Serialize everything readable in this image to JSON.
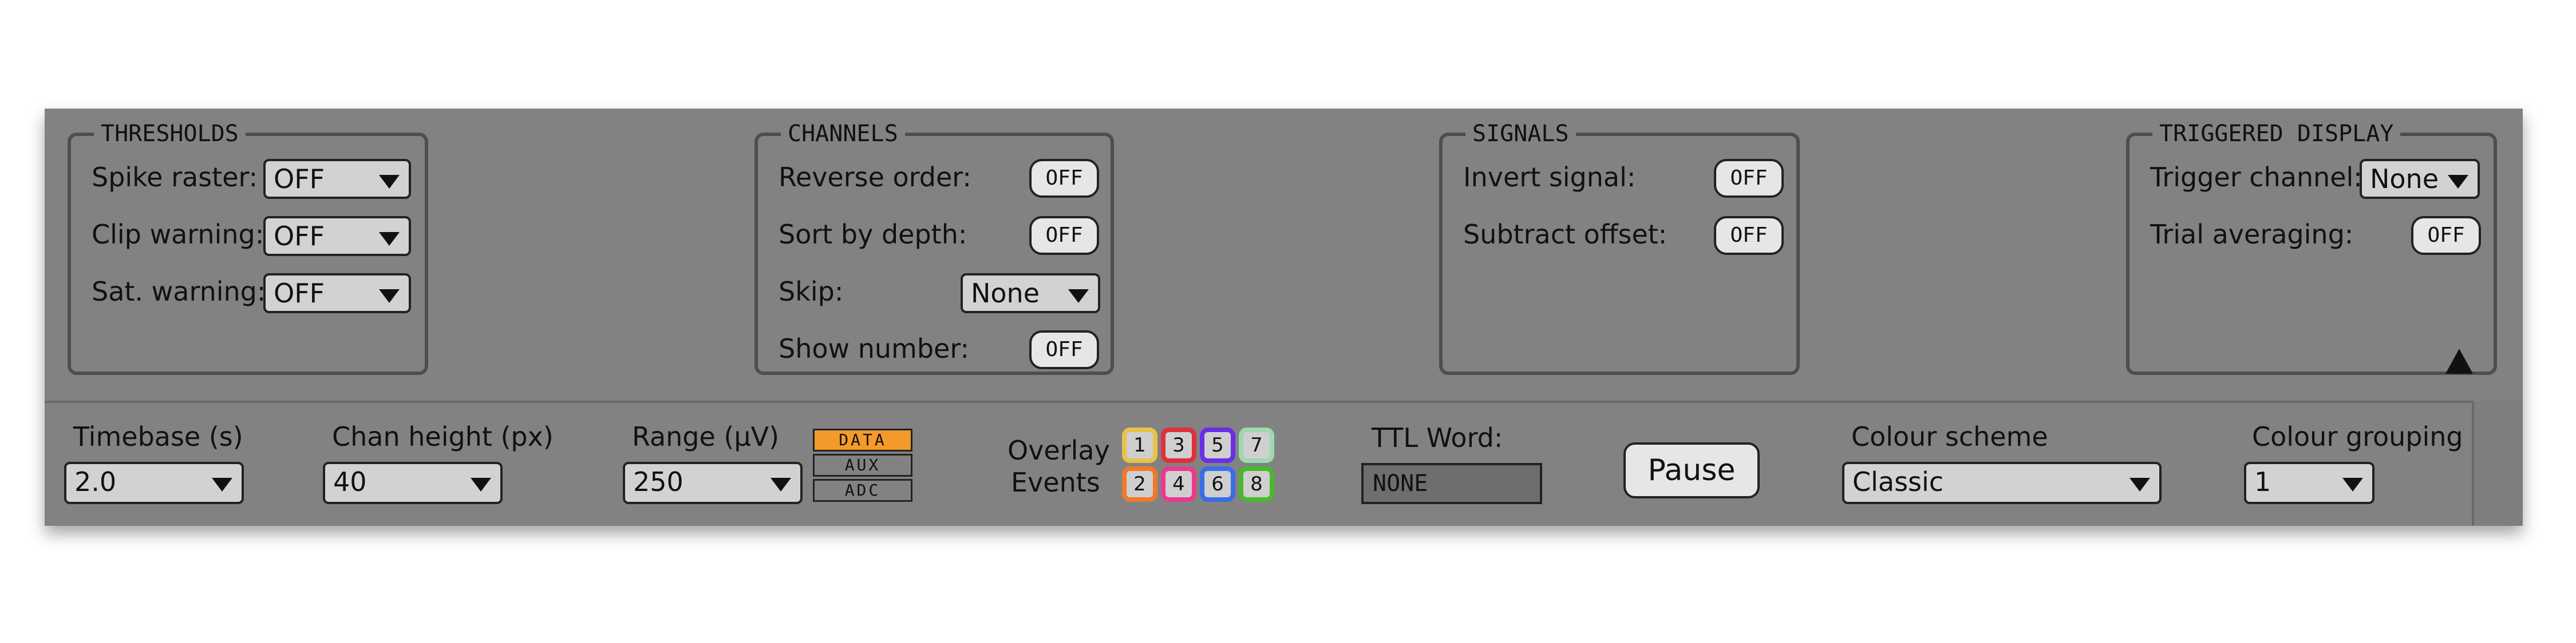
{
  "thresholds": {
    "title": "THRESHOLDS",
    "spike_raster": {
      "label": "Spike raster:",
      "value": "OFF"
    },
    "clip_warning": {
      "label": "Clip warning:",
      "value": "OFF"
    },
    "sat_warning": {
      "label": "Sat. warning:",
      "value": "OFF"
    }
  },
  "channels": {
    "title": "CHANNELS",
    "reverse_order": {
      "label": "Reverse order:",
      "value": "OFF"
    },
    "sort_by_depth": {
      "label": "Sort by depth:",
      "value": "OFF"
    },
    "skip": {
      "label": "Skip:",
      "value": "None"
    },
    "show_number": {
      "label": "Show number:",
      "value": "OFF"
    }
  },
  "signals": {
    "title": "SIGNALS",
    "invert_signal": {
      "label": "Invert signal:",
      "value": "OFF"
    },
    "subtract_offset": {
      "label": "Subtract offset:",
      "value": "OFF"
    }
  },
  "triggered_display": {
    "title": "TRIGGERED DISPLAY",
    "trigger_channel": {
      "label": "Trigger channel:",
      "value": "None"
    },
    "trial_averaging": {
      "label": "Trial averaging:",
      "value": "OFF"
    }
  },
  "bottom": {
    "timebase": {
      "label": "Timebase (s)",
      "value": "2.0"
    },
    "chan_height": {
      "label": "Chan height (px)",
      "value": "40"
    },
    "range": {
      "label": "Range (µV)",
      "value": "250"
    },
    "range_types": [
      {
        "label": "DATA",
        "active": true,
        "color": "#f39a2a"
      },
      {
        "label": "AUX",
        "active": false
      },
      {
        "label": "ADC",
        "active": false
      }
    ],
    "overlay_label_1": "Overlay",
    "overlay_label_2": "Events",
    "events": [
      {
        "num": "1",
        "color": "#e8c24a",
        "fill": "#cfcfcf"
      },
      {
        "num": "3",
        "color": "#e0303a",
        "fill": "#cfcfcf"
      },
      {
        "num": "5",
        "color": "#6a2ee6",
        "fill": "#cfcfcf"
      },
      {
        "num": "7",
        "color": "#9ed8b0",
        "fill": "#cfcfcf"
      },
      {
        "num": "2",
        "color": "#f07a2a",
        "fill": "#cfcfcf"
      },
      {
        "num": "4",
        "color": "#e83a8e",
        "fill": "#cfcfcf"
      },
      {
        "num": "6",
        "color": "#3a6ee6",
        "fill": "#cfcfcf"
      },
      {
        "num": "8",
        "color": "#4ab82e",
        "fill": "#cfcfcf"
      }
    ],
    "ttl_label": "TTL Word:",
    "ttl_value": "NONE",
    "pause_label": "Pause",
    "colour_scheme": {
      "label": "Colour scheme",
      "value": "Classic"
    },
    "colour_grouping": {
      "label": "Colour grouping",
      "value": "1"
    }
  },
  "collapse_icon": "up-triangle-icon"
}
